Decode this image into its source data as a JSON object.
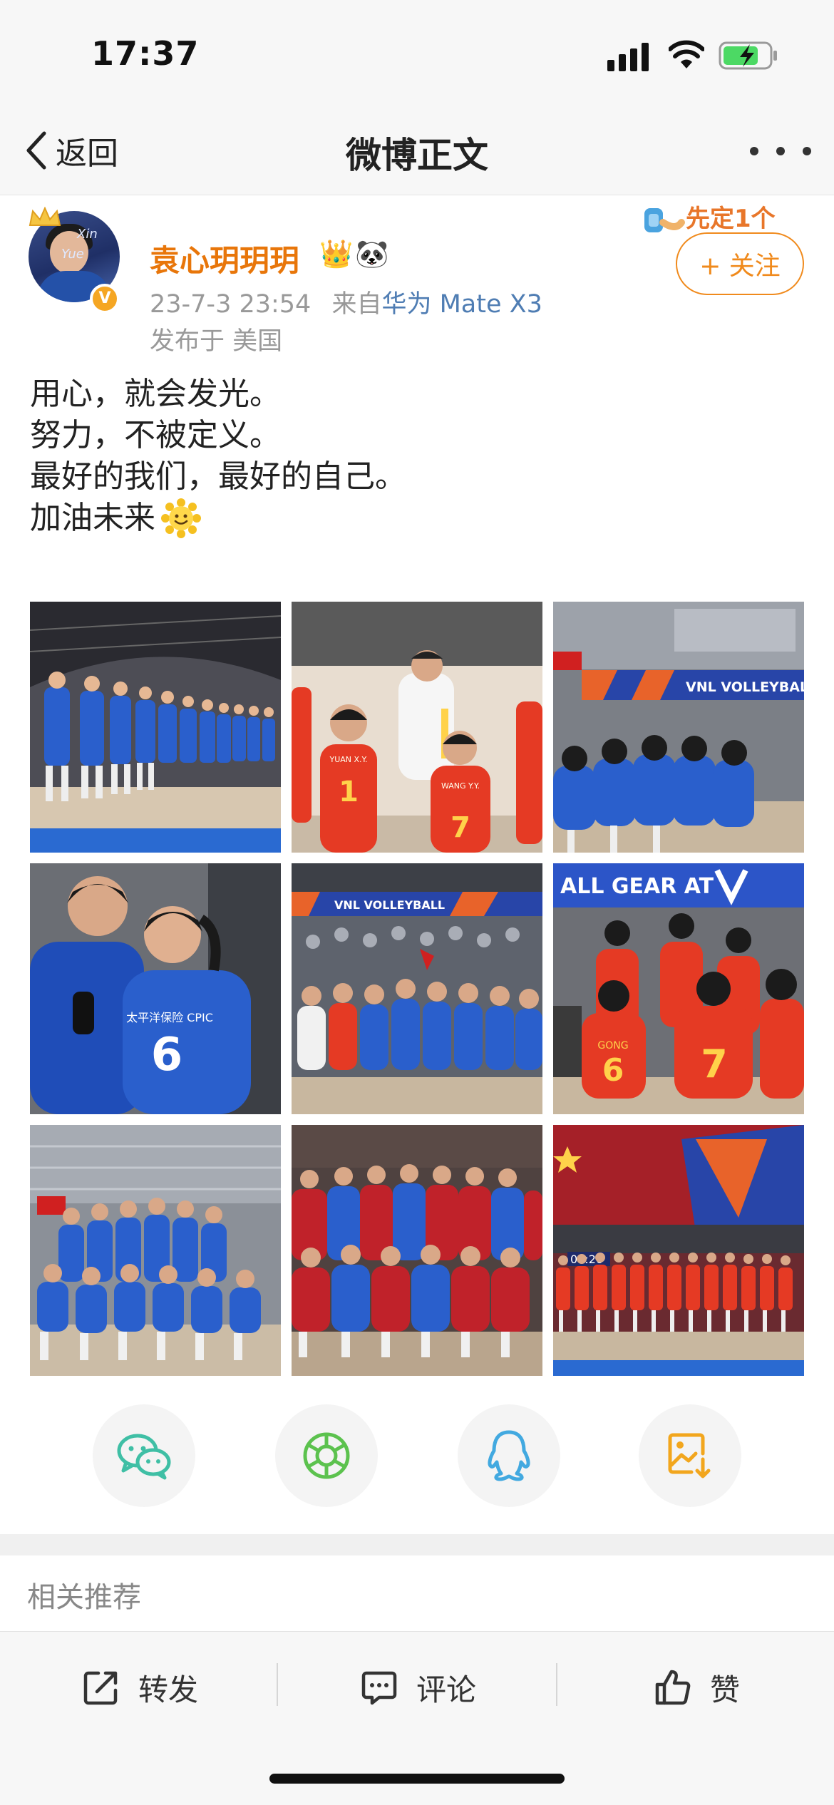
{
  "status_bar": {
    "time": "17:37"
  },
  "nav": {
    "back_label": "返回",
    "title": "微博正文"
  },
  "post": {
    "username": "袁心玥玥玥",
    "user_badges": [
      "👑",
      "🐼"
    ],
    "date": "23-7-3 23:54",
    "source_prefix": "来自",
    "source": "华为 Mate X3",
    "location": "发布于 美国",
    "avatar_text": [
      "Xin",
      "Yue"
    ],
    "verified_mark": "V",
    "follow_label": "+ 关注",
    "follow_deco_text": "先定1个",
    "lines": [
      "用心，就会发光。",
      "努力，不被定义。",
      "最好的我们，最好的自己。",
      "加油未来"
    ],
    "images": [
      {
        "caption": "team lineup blue jerseys"
      },
      {
        "caption": "coach with players in red",
        "jerseys": [
          "YUAN X.Y.",
          "1",
          "WANG Y.Y.",
          "7"
        ]
      },
      {
        "caption": "team huddle",
        "banner": "VNL VOLLEYBALL"
      },
      {
        "caption": "two players smiling",
        "jersey": "6",
        "sponsor": "太平洋保险 CPIC"
      },
      {
        "caption": "team celebration with fans",
        "banner": "VNL VOLLEYBALL"
      },
      {
        "caption": "players in red huddle",
        "banner": "ALL GEAR AT",
        "jerseys": [
          "GONG",
          "6",
          "7"
        ]
      },
      {
        "caption": "team photo blue"
      },
      {
        "caption": "team photo red jackets"
      },
      {
        "caption": "team lineup with flag",
        "timer": "01:26"
      }
    ]
  },
  "share": [
    "wechat-icon",
    "moments-icon",
    "qq-icon",
    "save-image-icon"
  ],
  "related_title": "相关推荐",
  "actions": {
    "repost": "转发",
    "comment": "评论",
    "like": "赞"
  },
  "colors": {
    "accent": "#f08a1c",
    "username": "#e8760a",
    "link": "#4f7db3"
  }
}
